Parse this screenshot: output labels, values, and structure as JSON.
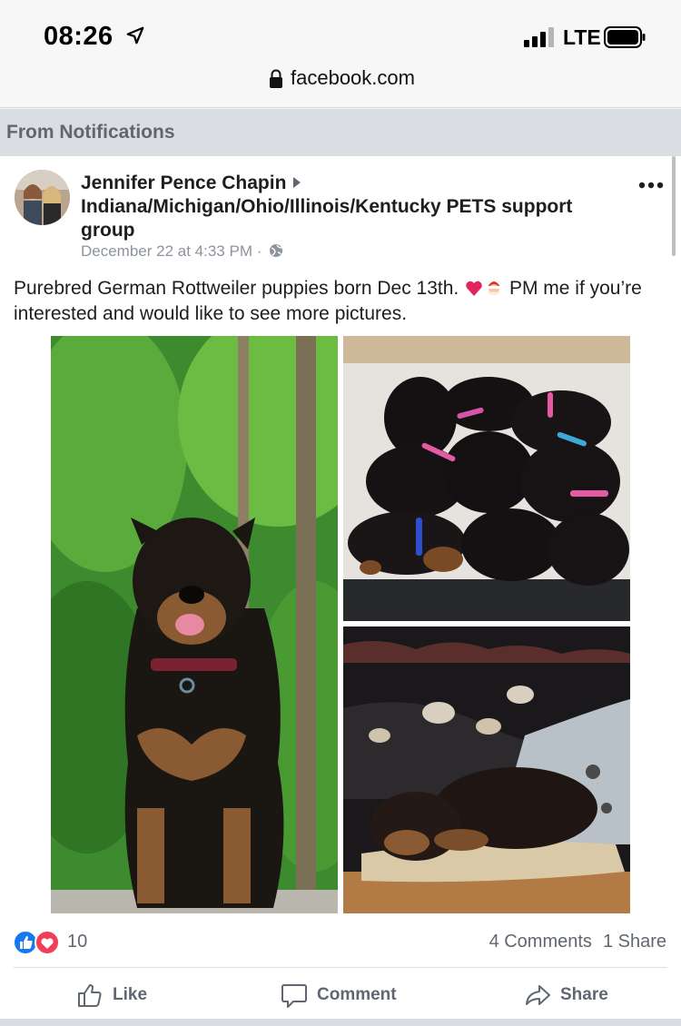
{
  "status_bar": {
    "time": "08:26",
    "network": "LTE"
  },
  "browser": {
    "url": "facebook.com"
  },
  "notification_header": "From Notifications",
  "post": {
    "author": "Jennifer Pence Chapin",
    "group": "Indiana/Michigan/Ohio/Illinois/Kentucky PETS support group",
    "timestamp": "December 22 at 4:33 PM",
    "separator": "·",
    "text_part1": "Purebred German Rottweiler puppies born Dec 13th.",
    "text_part2": "PM me if you’re interested and would like to see more pictures."
  },
  "engagement": {
    "reaction_count": "10",
    "comments": "4 Comments",
    "shares": "1 Share"
  },
  "actions": {
    "like": "Like",
    "comment": "Comment",
    "share": "Share"
  },
  "colors": {
    "fb_blue": "#1877f2",
    "love_red": "#f33e58",
    "muted": "#606770"
  }
}
